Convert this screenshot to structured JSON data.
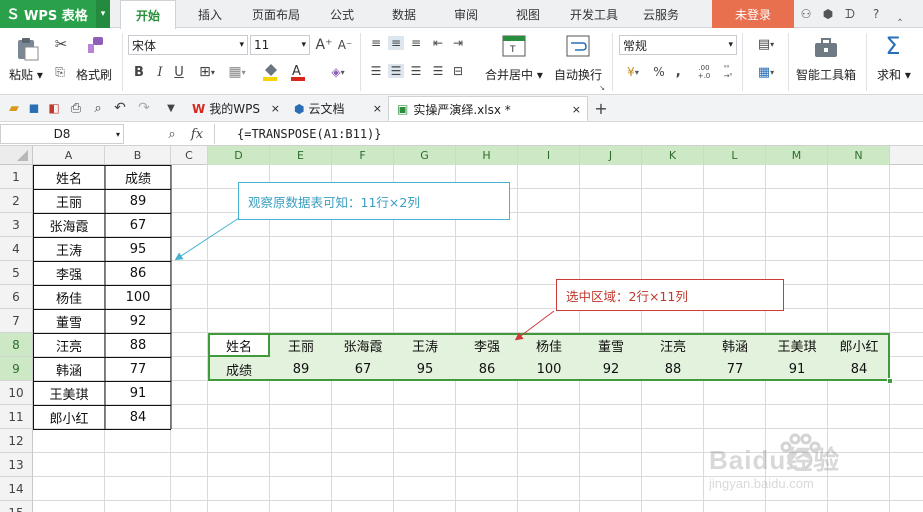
{
  "app": {
    "wps_label": "WPS 表格",
    "dropdown_glyph": "▾"
  },
  "menu_tabs": [
    "开始",
    "插入",
    "页面布局",
    "公式",
    "数据",
    "审阅",
    "视图",
    "开发工具",
    "云服务"
  ],
  "login_label": "未登录",
  "title_icons": [
    "⚇",
    "⬢",
    "ᗪ",
    "?",
    "‸"
  ],
  "ribbon": {
    "paste": "粘贴",
    "format_painter": "格式刷",
    "font_name": "宋体",
    "font_size": "11",
    "bold": "B",
    "italic": "I",
    "underline": "U",
    "merge_center": "合并居中",
    "wrap_text": "自动换行",
    "number_format": "常规",
    "percent": "%",
    "thousands": "‚",
    "inc_decimal": ".00\n+.0",
    "smart_tools": "智能工具箱",
    "sum": "求和",
    "sigma": "Σ"
  },
  "doc_tabs": [
    {
      "label": "我的WPS"
    },
    {
      "label": "云文档"
    },
    {
      "label": "实操严演绎.xlsx *"
    }
  ],
  "new_tab": "+",
  "formula_bar": {
    "name_box": "D8",
    "fx": "fx",
    "formula": "{=TRANSPOSE(A1:B11)}"
  },
  "columns": [
    "A",
    "B",
    "C",
    "D",
    "E",
    "F",
    "G",
    "H",
    "I",
    "J",
    "K",
    "L",
    "M",
    "N"
  ],
  "rows": [
    "1",
    "2",
    "3",
    "4",
    "5",
    "6",
    "7",
    "8",
    "9",
    "10",
    "11",
    "12",
    "13",
    "14",
    "15"
  ],
  "source_table": [
    [
      "姓名",
      "成绩"
    ],
    [
      "王丽",
      "89"
    ],
    [
      "张海霞",
      "67"
    ],
    [
      "王涛",
      "95"
    ],
    [
      "李强",
      "86"
    ],
    [
      "杨佳",
      "100"
    ],
    [
      "董雪",
      "92"
    ],
    [
      "汪亮",
      "88"
    ],
    [
      "韩涵",
      "77"
    ],
    [
      "王美琪",
      "91"
    ],
    [
      "郎小红",
      "84"
    ]
  ],
  "transposed_table": [
    [
      "姓名",
      "王丽",
      "张海霞",
      "王涛",
      "李强",
      "杨佳",
      "董雪",
      "汪亮",
      "韩涵",
      "王美琪",
      "郎小红"
    ],
    [
      "成绩",
      "89",
      "67",
      "95",
      "86",
      "100",
      "92",
      "88",
      "77",
      "91",
      "84"
    ]
  ],
  "notes": {
    "source": "观察原数据表可知：11行×2列",
    "selection": "选中区域：2行×11列"
  },
  "watermark": {
    "brand": "Baidu经验",
    "url": "jingyan.baidu.com"
  },
  "colors": {
    "accent": "#2a8f3d",
    "note_source": "#45b2cf",
    "note_selection": "#cc3a3a",
    "selection_fill": "#e3f2dc",
    "selection_border": "#3e9a3a"
  }
}
